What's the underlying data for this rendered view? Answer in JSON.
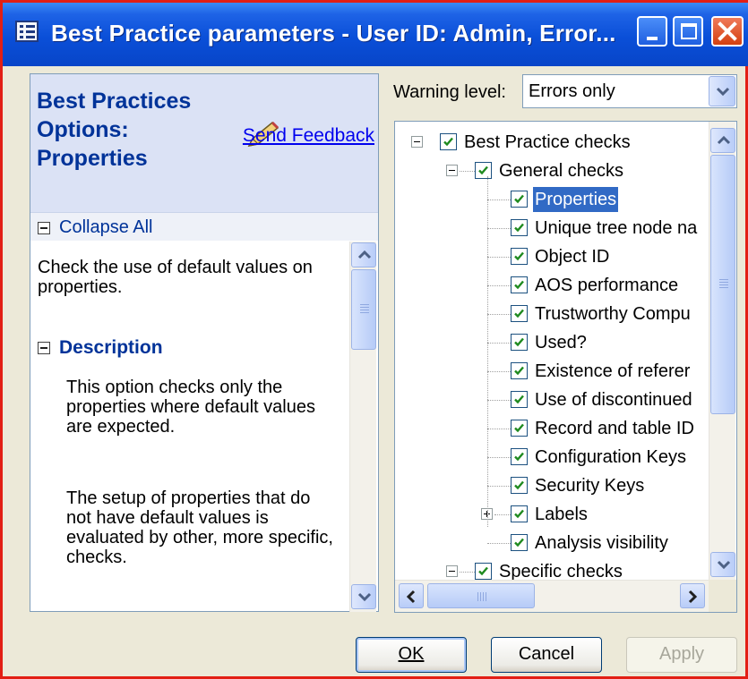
{
  "window": {
    "title": "Best Practice parameters - User ID: Admin, Error..."
  },
  "help": {
    "title": "Best Practices Options: Properties",
    "feedback_link": "Send Feedback",
    "collapse_all": "Collapse All",
    "intro": "Check the use of default values on properties.",
    "description_heading": "Description",
    "description_p1": "This option checks only the properties where default values are expected.",
    "description_p2": "The setup of properties that do not have default values is evaluated by other, more specific, checks."
  },
  "warning": {
    "label": "Warning level:",
    "value": "Errors only"
  },
  "tree": {
    "items": [
      {
        "label": "Best Practice checks",
        "checked": true,
        "level": 0,
        "expander": "minus"
      },
      {
        "label": "General checks",
        "checked": true,
        "level": 1,
        "expander": "minus"
      },
      {
        "label": "Properties",
        "checked": true,
        "level": 2,
        "selected": true
      },
      {
        "label": "Unique tree node na",
        "checked": true,
        "level": 2
      },
      {
        "label": "Object ID",
        "checked": true,
        "level": 2
      },
      {
        "label": "AOS performance",
        "checked": true,
        "level": 2
      },
      {
        "label": "Trustworthy Compu",
        "checked": true,
        "level": 2
      },
      {
        "label": "Used?",
        "checked": true,
        "level": 2
      },
      {
        "label": "Existence of referer",
        "checked": true,
        "level": 2
      },
      {
        "label": "Use of discontinued",
        "checked": true,
        "level": 2
      },
      {
        "label": "Record and table ID",
        "checked": true,
        "level": 2
      },
      {
        "label": "Configuration Keys",
        "checked": true,
        "level": 2
      },
      {
        "label": "Security Keys",
        "checked": true,
        "level": 2
      },
      {
        "label": "Labels",
        "checked": true,
        "level": 2,
        "expander": "plus"
      },
      {
        "label": "Analysis visibility",
        "checked": true,
        "level": 2
      },
      {
        "label": "Specific checks",
        "checked": true,
        "level": 1,
        "expander": "minus"
      }
    ]
  },
  "buttons": {
    "ok": "OK",
    "cancel": "Cancel",
    "apply": "Apply"
  },
  "colors": {
    "titlebar": "#0a4fd8",
    "selection": "#316ac5",
    "help_title": "#003399",
    "window_border": "#e21f14"
  }
}
